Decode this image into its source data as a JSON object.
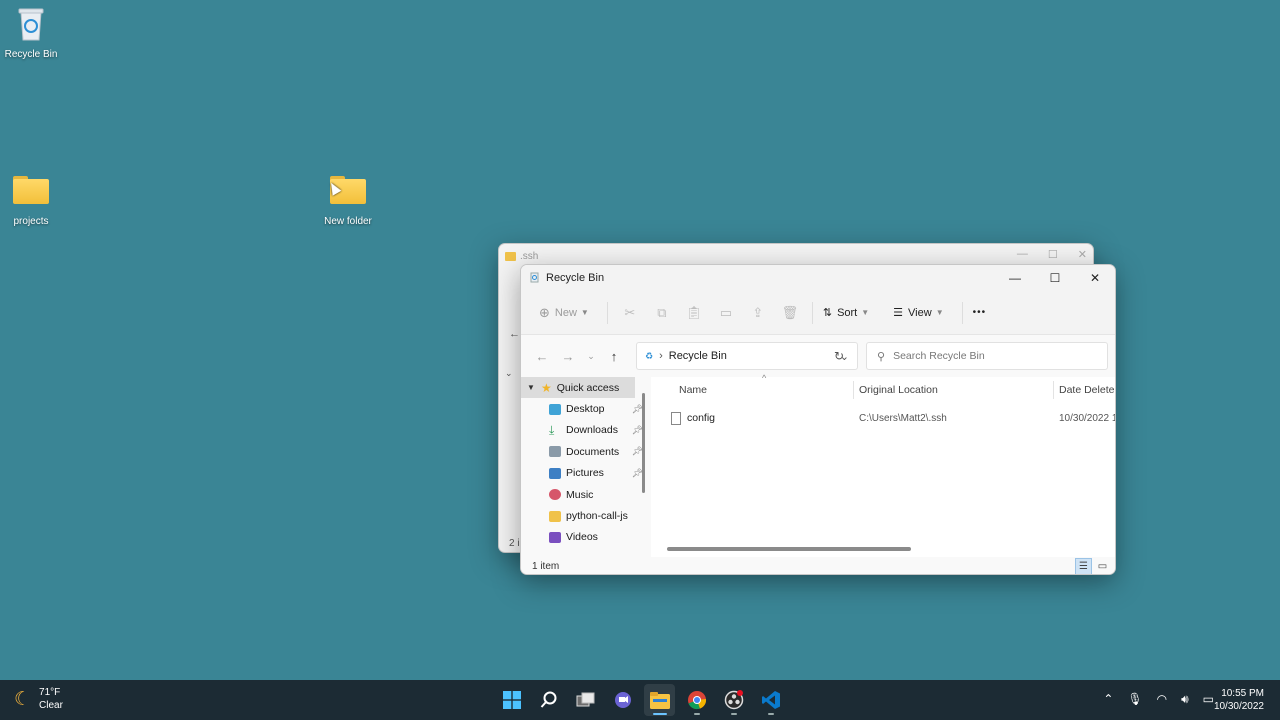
{
  "desktop": {
    "icons": [
      {
        "label": "Recycle Bin",
        "icon": "recycle-bin-icon"
      },
      {
        "label": "projects",
        "icon": "folder-icon"
      },
      {
        "label": "New folder",
        "icon": "folder-icon"
      }
    ]
  },
  "bg_window": {
    "title": ".ssh",
    "status_fragment": "2 i"
  },
  "window": {
    "title": "Recycle Bin",
    "controls": {
      "minimize": "—",
      "maximize": "☐",
      "close": "✕"
    },
    "toolbar": {
      "new_label": "New",
      "sort_label": "Sort",
      "view_label": "View",
      "more_label": "•••"
    },
    "address": {
      "crumb": "Recycle Bin"
    },
    "search": {
      "placeholder": "Search Recycle Bin"
    },
    "nav_pane": {
      "quick_access": "Quick access",
      "items": [
        {
          "label": "Desktop",
          "pinned": true,
          "color": "#3fa3d6"
        },
        {
          "label": "Downloads",
          "pinned": true,
          "color": "#2e9a5b"
        },
        {
          "label": "Documents",
          "pinned": true,
          "color": "#8a9aa8"
        },
        {
          "label": "Pictures",
          "pinned": true,
          "color": "#3d7fc4"
        },
        {
          "label": "Music",
          "pinned": false,
          "color": "#d6566a"
        },
        {
          "label": "python-call-js",
          "pinned": false,
          "color": "#f0c24a"
        },
        {
          "label": "Videos",
          "pinned": false,
          "color": "#7a4fbf"
        }
      ]
    },
    "columns": [
      "Name",
      "Original Location",
      "Date Deleted"
    ],
    "rows": [
      {
        "name": "config",
        "location": "C:\\Users\\Matt2\\.ssh",
        "date": "10/30/2022 1"
      }
    ],
    "status": "1 item"
  },
  "taskbar": {
    "weather": {
      "temp": "71°F",
      "condition": "Clear"
    },
    "apps": [
      "start-icon",
      "search-icon",
      "task-view-icon",
      "teams-chat-icon",
      "file-explorer-icon",
      "chrome-icon",
      "obs-icon",
      "vscode-icon"
    ],
    "clock": {
      "time": "10:55 PM",
      "date": "10/30/2022"
    }
  },
  "colors": {
    "desktop": "#3a8595",
    "taskbar": "#1c2b34",
    "folder": "#f2bf3a"
  }
}
